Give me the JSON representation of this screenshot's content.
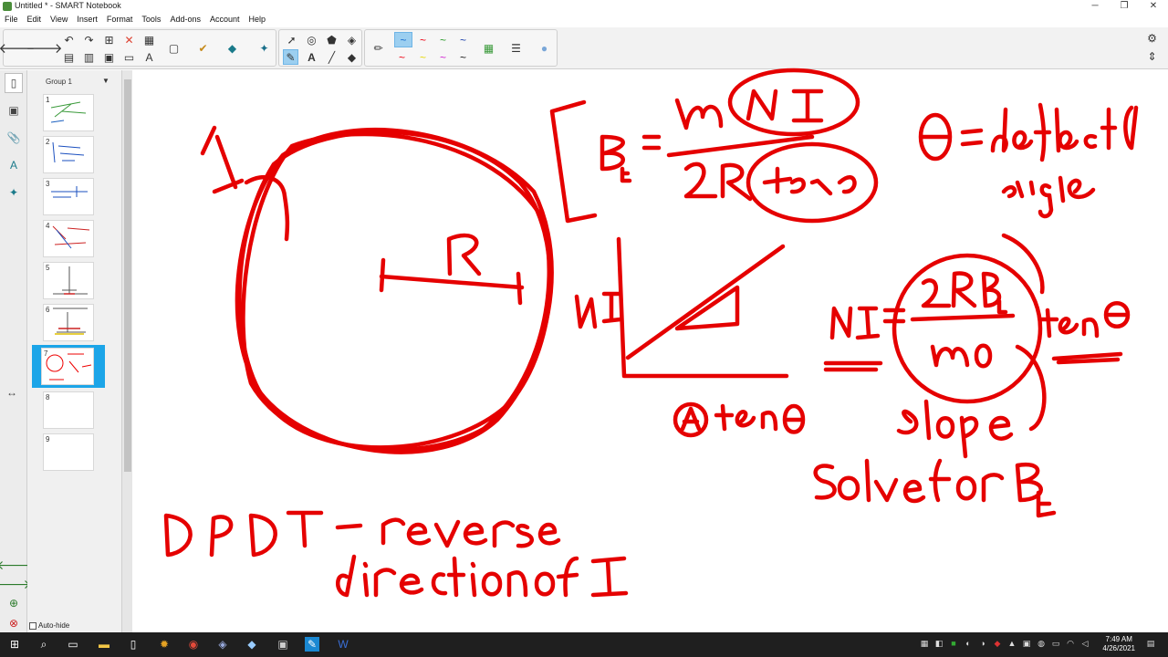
{
  "window": {
    "title": "Untitled * - SMART Notebook"
  },
  "menu": [
    "File",
    "Edit",
    "View",
    "Insert",
    "Format",
    "Tools",
    "Add-ons",
    "Account",
    "Help"
  ],
  "sorter": {
    "group_label": "Group 1",
    "pages": [
      "1",
      "2",
      "3",
      "4",
      "5",
      "6",
      "7",
      "8",
      "9"
    ],
    "selected_page": "7",
    "autohide_label": "Auto-hide"
  },
  "colors": {
    "ink": "#e50000",
    "selection": "#1ca5e8",
    "taskbar": "#1f1f1f"
  },
  "taskbar": {
    "time": "7:49 AM",
    "date": "4/26/2021"
  }
}
